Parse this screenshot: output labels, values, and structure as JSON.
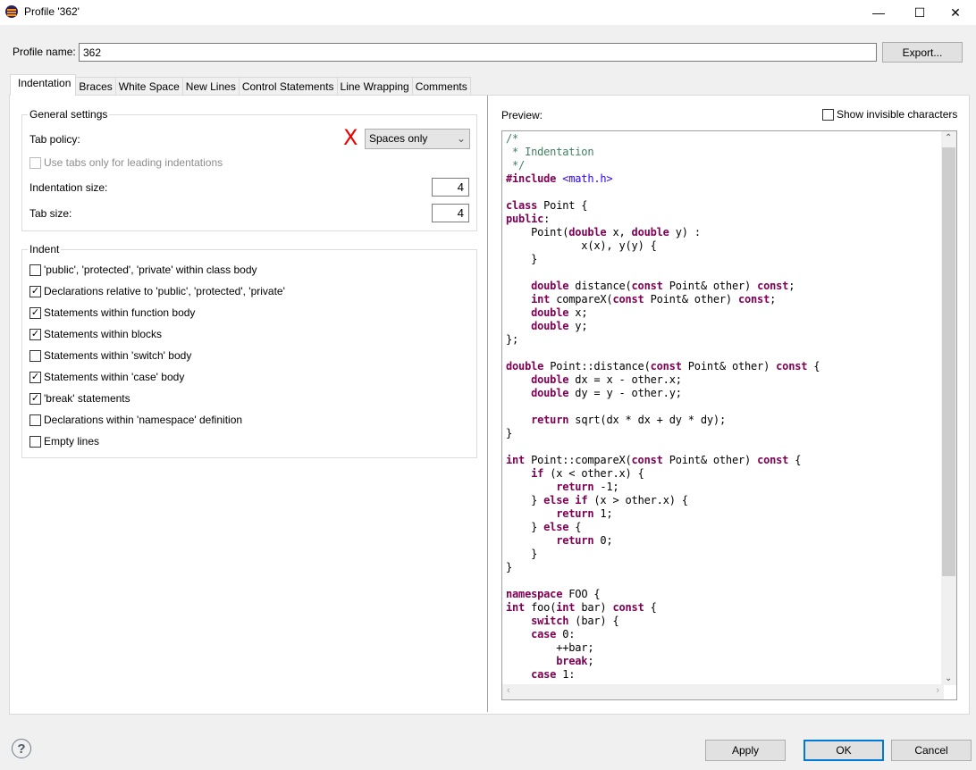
{
  "window": {
    "title": "Profile '362'",
    "minimize": "—",
    "maximize": "☐",
    "close": "✕"
  },
  "profile": {
    "label": "Profile name:",
    "value": "362",
    "export_label": "Export..."
  },
  "tabs": [
    "Indentation",
    "Braces",
    "White Space",
    "New Lines",
    "Control Statements",
    "Line Wrapping",
    "Comments"
  ],
  "active_tab": "Indentation",
  "general": {
    "title": "General settings",
    "tab_policy_label": "Tab policy:",
    "tab_policy_value": "Spaces only",
    "annotation_mark": "X",
    "use_tabs_label": "Use tabs only for leading indentations",
    "use_tabs_checked": false,
    "use_tabs_disabled": true,
    "indent_size_label": "Indentation size:",
    "indent_size": "4",
    "tab_size_label": "Tab size:",
    "tab_size": "4"
  },
  "indent": {
    "title": "Indent",
    "items": [
      {
        "label": "'public', 'protected', 'private' within class body",
        "checked": false
      },
      {
        "label": "Declarations relative to 'public', 'protected', 'private'",
        "checked": true
      },
      {
        "label": "Statements within function body",
        "checked": true
      },
      {
        "label": "Statements within blocks",
        "checked": true
      },
      {
        "label": "Statements within 'switch' body",
        "checked": false
      },
      {
        "label": "Statements within 'case' body",
        "checked": true
      },
      {
        "label": "'break' statements",
        "checked": true
      },
      {
        "label": "Declarations within 'namespace' definition",
        "checked": false
      },
      {
        "label": "Empty lines",
        "checked": false
      }
    ]
  },
  "preview": {
    "label": "Preview:",
    "show_invisible_label": "Show invisible characters",
    "show_invisible_checked": false,
    "keywords": [
      "class",
      "public",
      "double",
      "const",
      "int",
      "return",
      "if",
      "else",
      "namespace",
      "switch",
      "case",
      "break"
    ],
    "colors": {
      "keyword": "#7f0055",
      "comment": "#3f7f5f",
      "include": "#2a00ff"
    },
    "lines": [
      "/*",
      " * Indentation",
      " */",
      "#include <math.h>",
      "",
      "class Point {",
      "public:",
      "    Point(double x, double y) :",
      "            x(x), y(y) {",
      "    }",
      "",
      "    double distance(const Point& other) const;",
      "    int compareX(const Point& other) const;",
      "    double x;",
      "    double y;",
      "};",
      "",
      "double Point::distance(const Point& other) const {",
      "    double dx = x - other.x;",
      "    double dy = y - other.y;",
      "",
      "    return sqrt(dx * dx + dy * dy);",
      "}",
      "",
      "int Point::compareX(const Point& other) const {",
      "    if (x < other.x) {",
      "        return -1;",
      "    } else if (x > other.x) {",
      "        return 1;",
      "    } else {",
      "        return 0;",
      "    }",
      "}",
      "",
      "namespace FOO {",
      "int foo(int bar) const {",
      "    switch (bar) {",
      "    case 0:",
      "        ++bar;",
      "        break;",
      "    case 1:"
    ]
  },
  "buttons": {
    "help": "?",
    "apply": "Apply",
    "ok": "OK",
    "cancel": "Cancel"
  }
}
